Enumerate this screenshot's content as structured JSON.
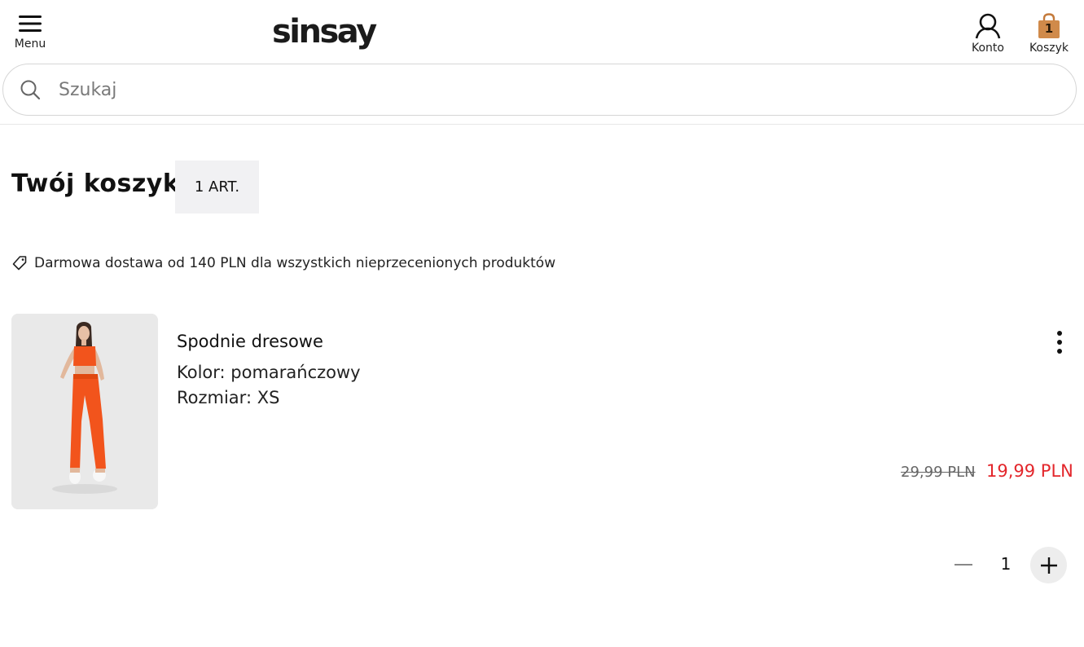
{
  "header": {
    "menu_label": "Menu",
    "logo_text": "sinsay",
    "account_label": "Konto",
    "cart_label": "Koszyk",
    "cart_count": "1"
  },
  "search": {
    "placeholder": "Szukaj",
    "value": ""
  },
  "cart": {
    "title": "Twój koszyk",
    "items_badge": "1 ART.",
    "promo_text": "Darmowa dostawa od 140 PLN dla wszystkich nieprzecenionych produktów"
  },
  "items": [
    {
      "name": "Spodnie dresowe",
      "color": "Kolor: pomarańczowy",
      "size": "Rozmiar: XS",
      "old_price": "29,99 PLN",
      "new_price": "19,99 PLN",
      "quantity": "1"
    }
  ],
  "icons": {
    "menu": "hamburger-icon",
    "account": "user-icon",
    "cart": "shopping-bag-icon",
    "search": "search-icon",
    "promo": "tag-icon",
    "more": "more-vertical-icon",
    "decrease": "minus-icon",
    "increase": "plus-icon"
  },
  "colors": {
    "sale_price": "#e3262b",
    "cart_bag": "#d08a4a",
    "badge_bg": "#f1f1f3",
    "product_accent": "#f2541c"
  }
}
